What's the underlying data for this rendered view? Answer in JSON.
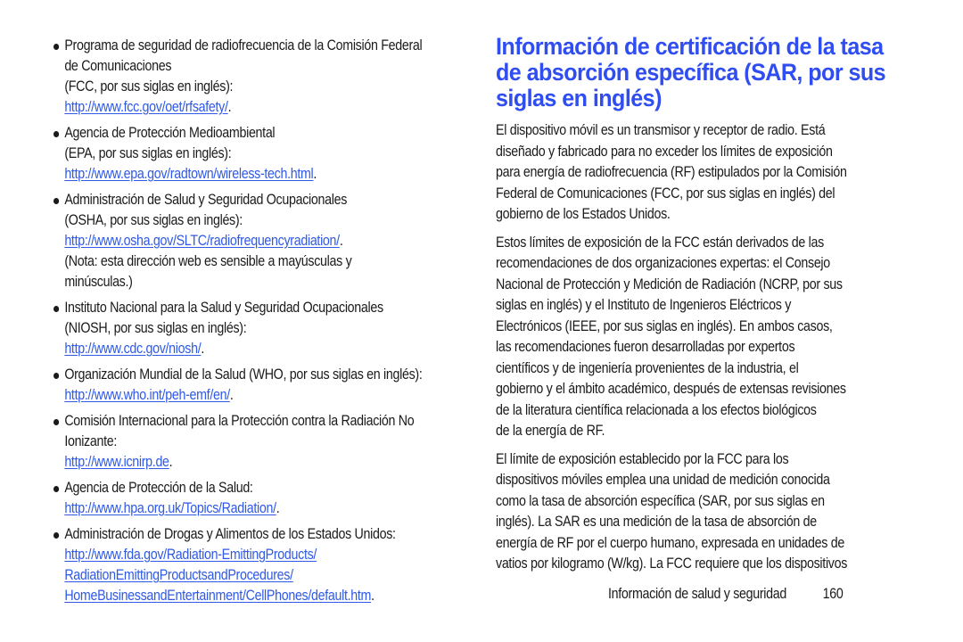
{
  "left_column": {
    "items": [
      {
        "lines": [
          "Programa de seguridad de radiofrecuencia de la Comisión Federal",
          "de Comunicaciones",
          "(FCC, por sus siglas en inglés):"
        ],
        "link_lines": [
          "http://www.fcc.gov/oet/rfsafety/"
        ],
        "trailing": "."
      },
      {
        "lines": [
          "Agencia de Protección Medioambiental",
          "(EPA, por sus siglas en inglés):"
        ],
        "link_lines": [
          "http://www.epa.gov/radtown/wireless-tech.html"
        ],
        "trailing": "."
      },
      {
        "lines": [
          "Administración de Salud y Seguridad Ocupacionales",
          "(OSHA, por sus siglas en inglés):"
        ],
        "link_lines": [
          "http://www.osha.gov/SLTC/radiofrequencyradiation/"
        ],
        "trailing": ".",
        "after_lines": [
          "(Nota: esta dirección web es sensible a mayúsculas y",
          "minúsculas.)"
        ]
      },
      {
        "lines": [
          "Instituto Nacional para la Salud y Seguridad Ocupacionales",
          "(NIOSH, por sus siglas en inglés):"
        ],
        "link_lines": [
          "http://www.cdc.gov/niosh/"
        ],
        "trailing": "."
      },
      {
        "lines": [
          "Organización Mundial de la Salud (WHO, por sus siglas en inglés):"
        ],
        "link_lines": [
          "http://www.who.int/peh-emf/en/"
        ],
        "trailing": "."
      },
      {
        "lines": [
          "Comisión Internacional para la Protección contra la Radiación No",
          "Ionizante:"
        ],
        "link_lines": [
          "http://www.icnirp.de"
        ],
        "trailing": "."
      },
      {
        "lines": [
          "Agencia de Protección de la Salud:"
        ],
        "link_lines": [
          "http://www.hpa.org.uk/Topics/Radiation/"
        ],
        "trailing": "."
      },
      {
        "lines": [
          "Administración de Drogas y Alimentos de los Estados Unidos:"
        ],
        "link_lines": [
          "http://www.fda.gov/Radiation-EmittingProducts/",
          "RadiationEmittingProductsandProcedures/",
          "HomeBusinessandEntertainment/CellPhones/default.htm"
        ],
        "trailing": "."
      }
    ]
  },
  "right_column": {
    "heading_lines": [
      "Información de certificación de la tasa",
      "de absorción específica (SAR, por sus",
      "siglas en inglés)"
    ],
    "paragraphs": [
      [
        "El dispositivo móvil es un transmisor y receptor de radio. Está",
        "diseñado y fabricado para no exceder los límites de exposición",
        "para energía de radiofrecuencia (RF) estipulados por la Comisión",
        "Federal de Comunicaciones (FCC, por sus siglas en inglés) del",
        "gobierno de los Estados Unidos."
      ],
      [
        "Estos límites de exposición de la FCC están derivados de las",
        "recomendaciones de dos organizaciones expertas: el Consejo",
        "Nacional de Protección y Medición de Radiación (NCRP, por sus",
        "siglas en inglés) y el Instituto de Ingenieros Eléctricos y",
        "Electrónicos (IEEE, por sus siglas en inglés). En ambos casos,",
        "las recomendaciones fueron desarrolladas por expertos",
        "científicos y de ingeniería provenientes de la industria, el",
        "gobierno y el ámbito académico, después de extensas revisiones",
        "de la literatura científica relacionada a los efectos biológicos",
        "de la energía de RF."
      ],
      [
        "El límite de exposición establecido por la FCC para los",
        "dispositivos móviles emplea una unidad de medición conocida",
        "como la tasa de absorción específica (SAR, por sus siglas en",
        "inglés). La SAR es una medición de la tasa de absorción de",
        "energía de RF por el cuerpo humano, expresada en unidades de",
        "vatios por kilogramo (W/kg). La FCC requiere que los dispositivos"
      ]
    ]
  },
  "footer": {
    "section_name": "Información de salud y seguridad",
    "page_number": "160"
  },
  "colors": {
    "heading": "#2f4df0",
    "link": "#2f59e6",
    "text": "#1a1a1a"
  }
}
